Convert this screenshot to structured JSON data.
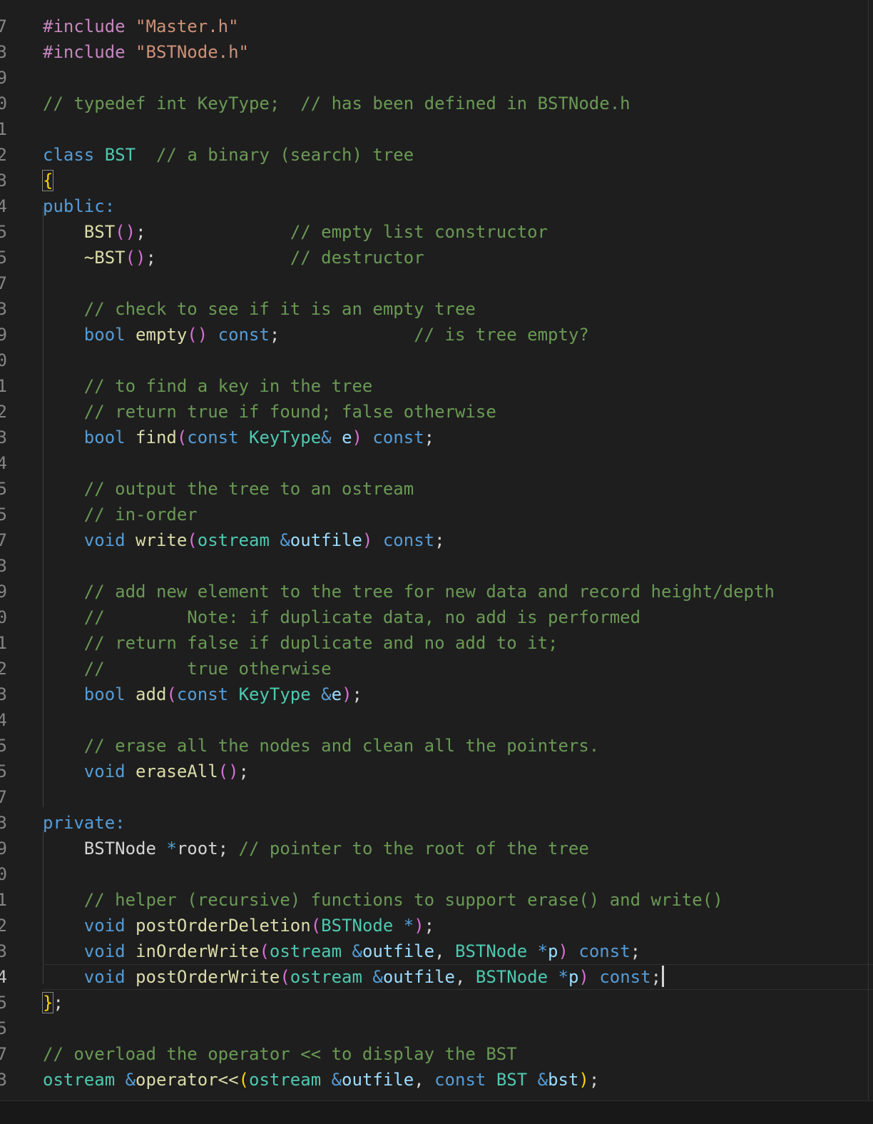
{
  "editor": {
    "language": "cpp",
    "gutter": [
      "7",
      "3",
      "9",
      "0",
      "1",
      "2",
      "3",
      "4",
      "5",
      "5",
      "7",
      "3",
      "9",
      "0",
      "1",
      "2",
      "3",
      "4",
      "5",
      "5",
      "7",
      "3",
      "9",
      "0",
      "1",
      "2",
      "3",
      "4",
      "5",
      "5",
      "7",
      "3",
      "9",
      "0",
      "1",
      "2",
      "3",
      "4",
      "5",
      "5",
      "7",
      "3"
    ],
    "active_line": 37,
    "colors": {
      "background": "#1e1e1e",
      "preproc": "#c586c0",
      "string": "#ce9178",
      "comment": "#6a9955",
      "keyword": "#569cd6",
      "type": "#4ec9b0",
      "function": "#dcdcaa",
      "variable": "#9cdcfe",
      "brace": "#ffd700",
      "paren": "#da70d6"
    },
    "lines": [
      [
        [
          "preproc",
          "#include "
        ],
        [
          "string",
          "\"Master.h\""
        ]
      ],
      [
        [
          "preproc",
          "#include "
        ],
        [
          "string",
          "\"BSTNode.h\""
        ]
      ],
      [],
      [
        [
          "comment",
          "// typedef int KeyType;  // has been defined in BSTNode.h"
        ]
      ],
      [],
      [
        [
          "keyword",
          "class "
        ],
        [
          "type",
          "BST"
        ],
        [
          "plain",
          "  "
        ],
        [
          "comment",
          "// a binary (search) tree"
        ]
      ],
      [
        [
          "brace",
          "{"
        ]
      ],
      [
        [
          "keyword",
          "public:"
        ]
      ],
      [
        [
          "plain",
          "    "
        ],
        [
          "func",
          "BST"
        ],
        [
          "paren",
          "()"
        ],
        [
          "plain",
          ";              "
        ],
        [
          "comment",
          "// empty list constructor"
        ]
      ],
      [
        [
          "plain",
          "    "
        ],
        [
          "func",
          "~BST"
        ],
        [
          "paren",
          "()"
        ],
        [
          "plain",
          ";             "
        ],
        [
          "comment",
          "// destructor"
        ]
      ],
      [],
      [
        [
          "plain",
          "    "
        ],
        [
          "comment",
          "// check to see if it is an empty tree"
        ]
      ],
      [
        [
          "plain",
          "    "
        ],
        [
          "keyword",
          "bool "
        ],
        [
          "func",
          "empty"
        ],
        [
          "paren",
          "()"
        ],
        [
          "plain",
          " "
        ],
        [
          "keyword",
          "const"
        ],
        [
          "plain",
          ";             "
        ],
        [
          "comment",
          "// is tree empty?"
        ]
      ],
      [],
      [
        [
          "plain",
          "    "
        ],
        [
          "comment",
          "// to find a key in the tree"
        ]
      ],
      [
        [
          "plain",
          "    "
        ],
        [
          "comment",
          "// return true if found; false otherwise"
        ]
      ],
      [
        [
          "plain",
          "    "
        ],
        [
          "keyword",
          "bool "
        ],
        [
          "func",
          "find"
        ],
        [
          "paren",
          "("
        ],
        [
          "keyword",
          "const "
        ],
        [
          "type",
          "KeyType"
        ],
        [
          "op",
          "& "
        ],
        [
          "var",
          "e"
        ],
        [
          "paren",
          ")"
        ],
        [
          "plain",
          " "
        ],
        [
          "keyword",
          "const"
        ],
        [
          "plain",
          ";"
        ]
      ],
      [],
      [
        [
          "plain",
          "    "
        ],
        [
          "comment",
          "// output the tree to an ostream"
        ]
      ],
      [
        [
          "plain",
          "    "
        ],
        [
          "comment",
          "// in-order"
        ]
      ],
      [
        [
          "plain",
          "    "
        ],
        [
          "keyword",
          "void "
        ],
        [
          "func",
          "write"
        ],
        [
          "paren",
          "("
        ],
        [
          "type",
          "ostream "
        ],
        [
          "op",
          "&"
        ],
        [
          "var",
          "outfile"
        ],
        [
          "paren",
          ")"
        ],
        [
          "plain",
          " "
        ],
        [
          "keyword",
          "const"
        ],
        [
          "plain",
          ";"
        ]
      ],
      [],
      [
        [
          "plain",
          "    "
        ],
        [
          "comment",
          "// add new element to the tree for new data and record height/depth"
        ]
      ],
      [
        [
          "plain",
          "    "
        ],
        [
          "comment",
          "//        Note: if duplicate data, no add is performed"
        ]
      ],
      [
        [
          "plain",
          "    "
        ],
        [
          "comment",
          "// return false if duplicate and no add to it;"
        ]
      ],
      [
        [
          "plain",
          "    "
        ],
        [
          "comment",
          "//        true otherwise"
        ]
      ],
      [
        [
          "plain",
          "    "
        ],
        [
          "keyword",
          "bool "
        ],
        [
          "func",
          "add"
        ],
        [
          "paren",
          "("
        ],
        [
          "keyword",
          "const "
        ],
        [
          "type",
          "KeyType "
        ],
        [
          "op",
          "&"
        ],
        [
          "var",
          "e"
        ],
        [
          "paren",
          ")"
        ],
        [
          "plain",
          ";"
        ]
      ],
      [],
      [
        [
          "plain",
          "    "
        ],
        [
          "comment",
          "// erase all the nodes and clean all the pointers."
        ]
      ],
      [
        [
          "plain",
          "    "
        ],
        [
          "keyword",
          "void "
        ],
        [
          "func",
          "eraseAll"
        ],
        [
          "paren",
          "()"
        ],
        [
          "plain",
          ";"
        ]
      ],
      [],
      [
        [
          "keyword",
          "private:"
        ]
      ],
      [
        [
          "plain",
          "    "
        ],
        [
          "plain",
          "BSTNode "
        ],
        [
          "op",
          "*"
        ],
        [
          "plain",
          "root; "
        ],
        [
          "comment",
          "// pointer to the root of the tree"
        ]
      ],
      [],
      [
        [
          "plain",
          "    "
        ],
        [
          "comment",
          "// helper (recursive) functions to support erase() and write()"
        ]
      ],
      [
        [
          "plain",
          "    "
        ],
        [
          "keyword",
          "void "
        ],
        [
          "func",
          "postOrderDeletion"
        ],
        [
          "paren",
          "("
        ],
        [
          "type",
          "BSTNode "
        ],
        [
          "op",
          "*"
        ],
        [
          "paren",
          ")"
        ],
        [
          "plain",
          ";"
        ]
      ],
      [
        [
          "plain",
          "    "
        ],
        [
          "keyword",
          "void "
        ],
        [
          "func",
          "inOrderWrite"
        ],
        [
          "paren",
          "("
        ],
        [
          "type",
          "ostream "
        ],
        [
          "op",
          "&"
        ],
        [
          "var",
          "outfile"
        ],
        [
          "plain",
          ", "
        ],
        [
          "type",
          "BSTNode "
        ],
        [
          "op",
          "*"
        ],
        [
          "var",
          "p"
        ],
        [
          "paren",
          ")"
        ],
        [
          "plain",
          " "
        ],
        [
          "keyword",
          "const"
        ],
        [
          "plain",
          ";"
        ]
      ],
      [
        [
          "plain",
          "    "
        ],
        [
          "keyword",
          "void "
        ],
        [
          "func",
          "postOrderWrite"
        ],
        [
          "paren",
          "("
        ],
        [
          "type",
          "ostream "
        ],
        [
          "op",
          "&"
        ],
        [
          "var",
          "outfile"
        ],
        [
          "plain",
          ", "
        ],
        [
          "type",
          "BSTNode "
        ],
        [
          "op",
          "*"
        ],
        [
          "var",
          "p"
        ],
        [
          "paren",
          ")"
        ],
        [
          "plain",
          " "
        ],
        [
          "keyword",
          "const"
        ],
        [
          "plain",
          ";"
        ]
      ],
      [
        [
          "brace",
          "}"
        ],
        [
          "plain",
          ";"
        ]
      ],
      [],
      [
        [
          "comment",
          "// overload the operator << to display the BST"
        ]
      ],
      [
        [
          "type",
          "ostream "
        ],
        [
          "op",
          "&"
        ],
        [
          "func",
          "operator<<"
        ],
        [
          "brace",
          "("
        ],
        [
          "type",
          "ostream "
        ],
        [
          "op",
          "&"
        ],
        [
          "var",
          "outfile"
        ],
        [
          "plain",
          ", "
        ],
        [
          "keyword",
          "const "
        ],
        [
          "type",
          "BST "
        ],
        [
          "op",
          "&"
        ],
        [
          "var",
          "bst"
        ],
        [
          "brace",
          ")"
        ],
        [
          "plain",
          ";"
        ]
      ]
    ]
  }
}
